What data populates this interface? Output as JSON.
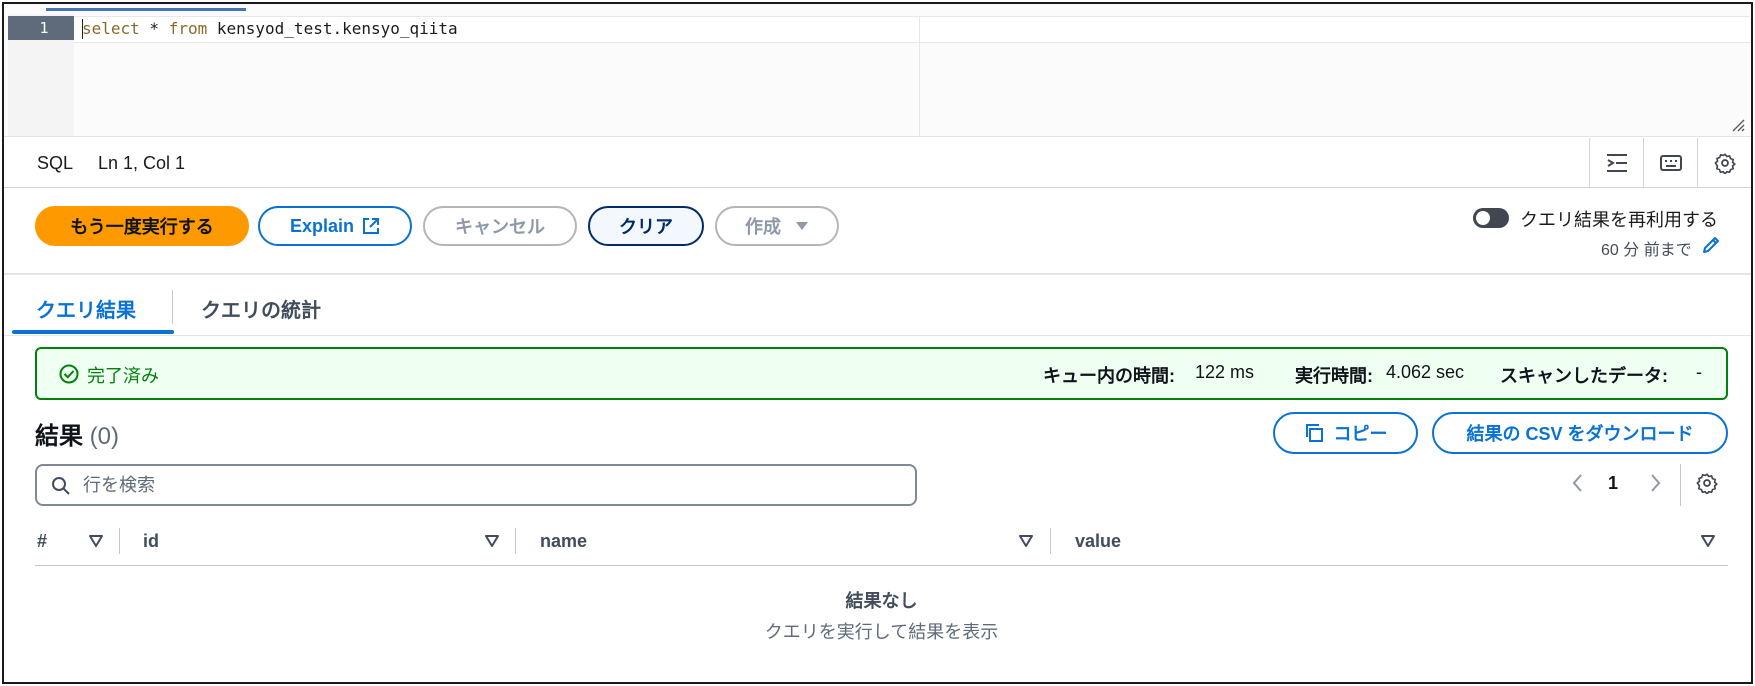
{
  "editor": {
    "line_number": "1",
    "query_keyword_select": "select",
    "query_star": " * ",
    "query_keyword_from": "from",
    "query_table": " kensyod_test.kensyo_qiita"
  },
  "statusbar": {
    "language": "SQL",
    "cursor_position": "Ln 1, Col 1",
    "icons": [
      "indent-icon",
      "keyboard-icon",
      "gear-icon"
    ]
  },
  "actions": {
    "run_again_label": "もう一度実行する",
    "explain_label": "Explain",
    "cancel_label": "キャンセル",
    "clear_label": "クリア",
    "create_label": "作成",
    "reuse_label": "クエリ結果を再利用する",
    "reuse_sub": "60 分 前まで",
    "reuse_enabled": false
  },
  "tabs": [
    {
      "label": "クエリ結果",
      "active": true
    },
    {
      "label": "クエリの統計",
      "active": false
    }
  ],
  "banner": {
    "status": "完了済み",
    "queue_time_label": "キュー内の時間:",
    "queue_time_value": "122 ms",
    "run_time_label": "実行時間:",
    "run_time_value": "4.062 sec",
    "scanned_label": "スキャンしたデータ:",
    "scanned_value": "-"
  },
  "results": {
    "title": "結果",
    "count": "(0)",
    "copy_label": "コピー",
    "csv_label": "結果の CSV をダウンロード",
    "search_placeholder": "行を検索",
    "page_current": "1",
    "columns": [
      "#",
      "id",
      "name",
      "value"
    ],
    "empty_title": "結果なし",
    "empty_sub": "クエリを実行して結果を表示"
  },
  "colors": {
    "primary": "#ff9900",
    "link": "#0972d3",
    "success": "#037f0c",
    "success_bg": "#effff1"
  }
}
